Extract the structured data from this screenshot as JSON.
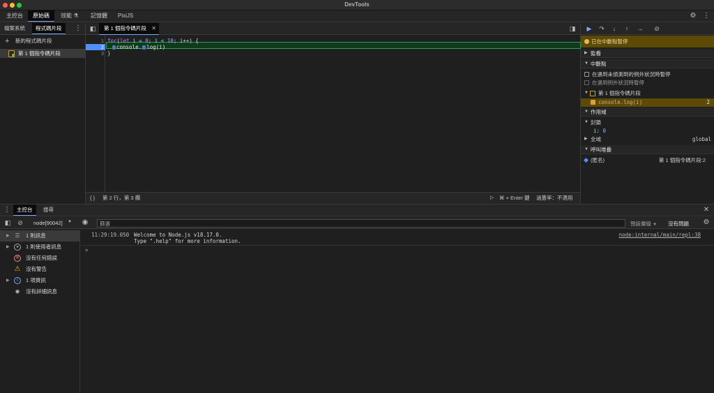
{
  "window": {
    "title": "DevTools"
  },
  "main_tabs": [
    {
      "label": "主控台"
    },
    {
      "label": "原始碼"
    },
    {
      "label": "效能 ⚗"
    },
    {
      "label": "記憶體"
    },
    {
      "label": "PixiJS"
    }
  ],
  "main_tabs_active": "原始碼",
  "navigator": {
    "tabs": [
      {
        "label": "檔案系統"
      },
      {
        "label": "程式碼片段"
      }
    ],
    "new_snippet_label": "新的程式碼片段",
    "snippets": [
      {
        "label": "第 1 個指令碼片段"
      }
    ]
  },
  "editor": {
    "tab_label": "第 1 個指令碼片段",
    "line_numbers": [
      "1",
      "2",
      "3"
    ],
    "code": {
      "line1_tokens": [
        "for",
        "(",
        "let",
        " i = ",
        "0",
        "; i < ",
        "10",
        "; i++) {"
      ],
      "line2_obj": "console",
      "line2_rest": ".",
      "line2_fn": "log(i)",
      "line3": "}"
    },
    "status": {
      "braces": "{ }",
      "position": "第 2 行，第 3 欄",
      "run_hint": "⌘ + Enter 鍵",
      "coverage": "涵蓋率：不適用"
    }
  },
  "debugger": {
    "paused_label": "已在中斷點暫停",
    "sections": {
      "watch": "監看",
      "breakpoints": "中斷點",
      "scope": "作用域",
      "call_stack": "呼叫堆疊"
    },
    "pause_uncaught": "在遇到未偵測到的例外狀況時暫停",
    "pause_caught": "在遇到例外狀況時暫停",
    "bp_file": "第 1 個指令碼片段",
    "bp_code": "console.log(i)",
    "bp_line": "2",
    "scope": {
      "closure_label": "封鎖",
      "var_name": "i:",
      "var_value": "0",
      "global_label": "全域",
      "global_value": "global"
    },
    "call_frame": {
      "name": "(匿名)",
      "location": "第 1 個指令碼片段:2"
    }
  },
  "drawer": {
    "tabs": [
      {
        "label": "主控台"
      },
      {
        "label": "搜尋"
      }
    ],
    "context": "node[90042]",
    "filter_placeholder": "篩選",
    "levels": "預設層級",
    "issues": "沒有問題"
  },
  "console_sidebar": [
    {
      "label": "1 則訊息",
      "icon": "list-icon",
      "expandable": true
    },
    {
      "label": "1 則使用者訊息",
      "icon": "user-icon",
      "expandable": true
    },
    {
      "label": "沒有任何錯誤",
      "icon": "error-icon",
      "expandable": false
    },
    {
      "label": "沒有警告",
      "icon": "warning-icon",
      "expandable": false
    },
    {
      "label": "1 項資訊",
      "icon": "info-icon",
      "expandable": true
    },
    {
      "label": "沒有詳細訊息",
      "icon": "bug-icon",
      "expandable": false
    }
  ],
  "console_log": {
    "timestamp": "11:29:19.050",
    "message_line1": "Welcome to Node.js v18.17.0.",
    "message_line2": "Type \".help\" for more information.",
    "source": "node:internal/main/repl:38",
    "prompt": ">"
  },
  "colors": {
    "accent": "#7cacf8",
    "paused_bg": "#5e4a07",
    "exec_line": "#2c9f55",
    "breakpoint": "#4f8ff7"
  }
}
